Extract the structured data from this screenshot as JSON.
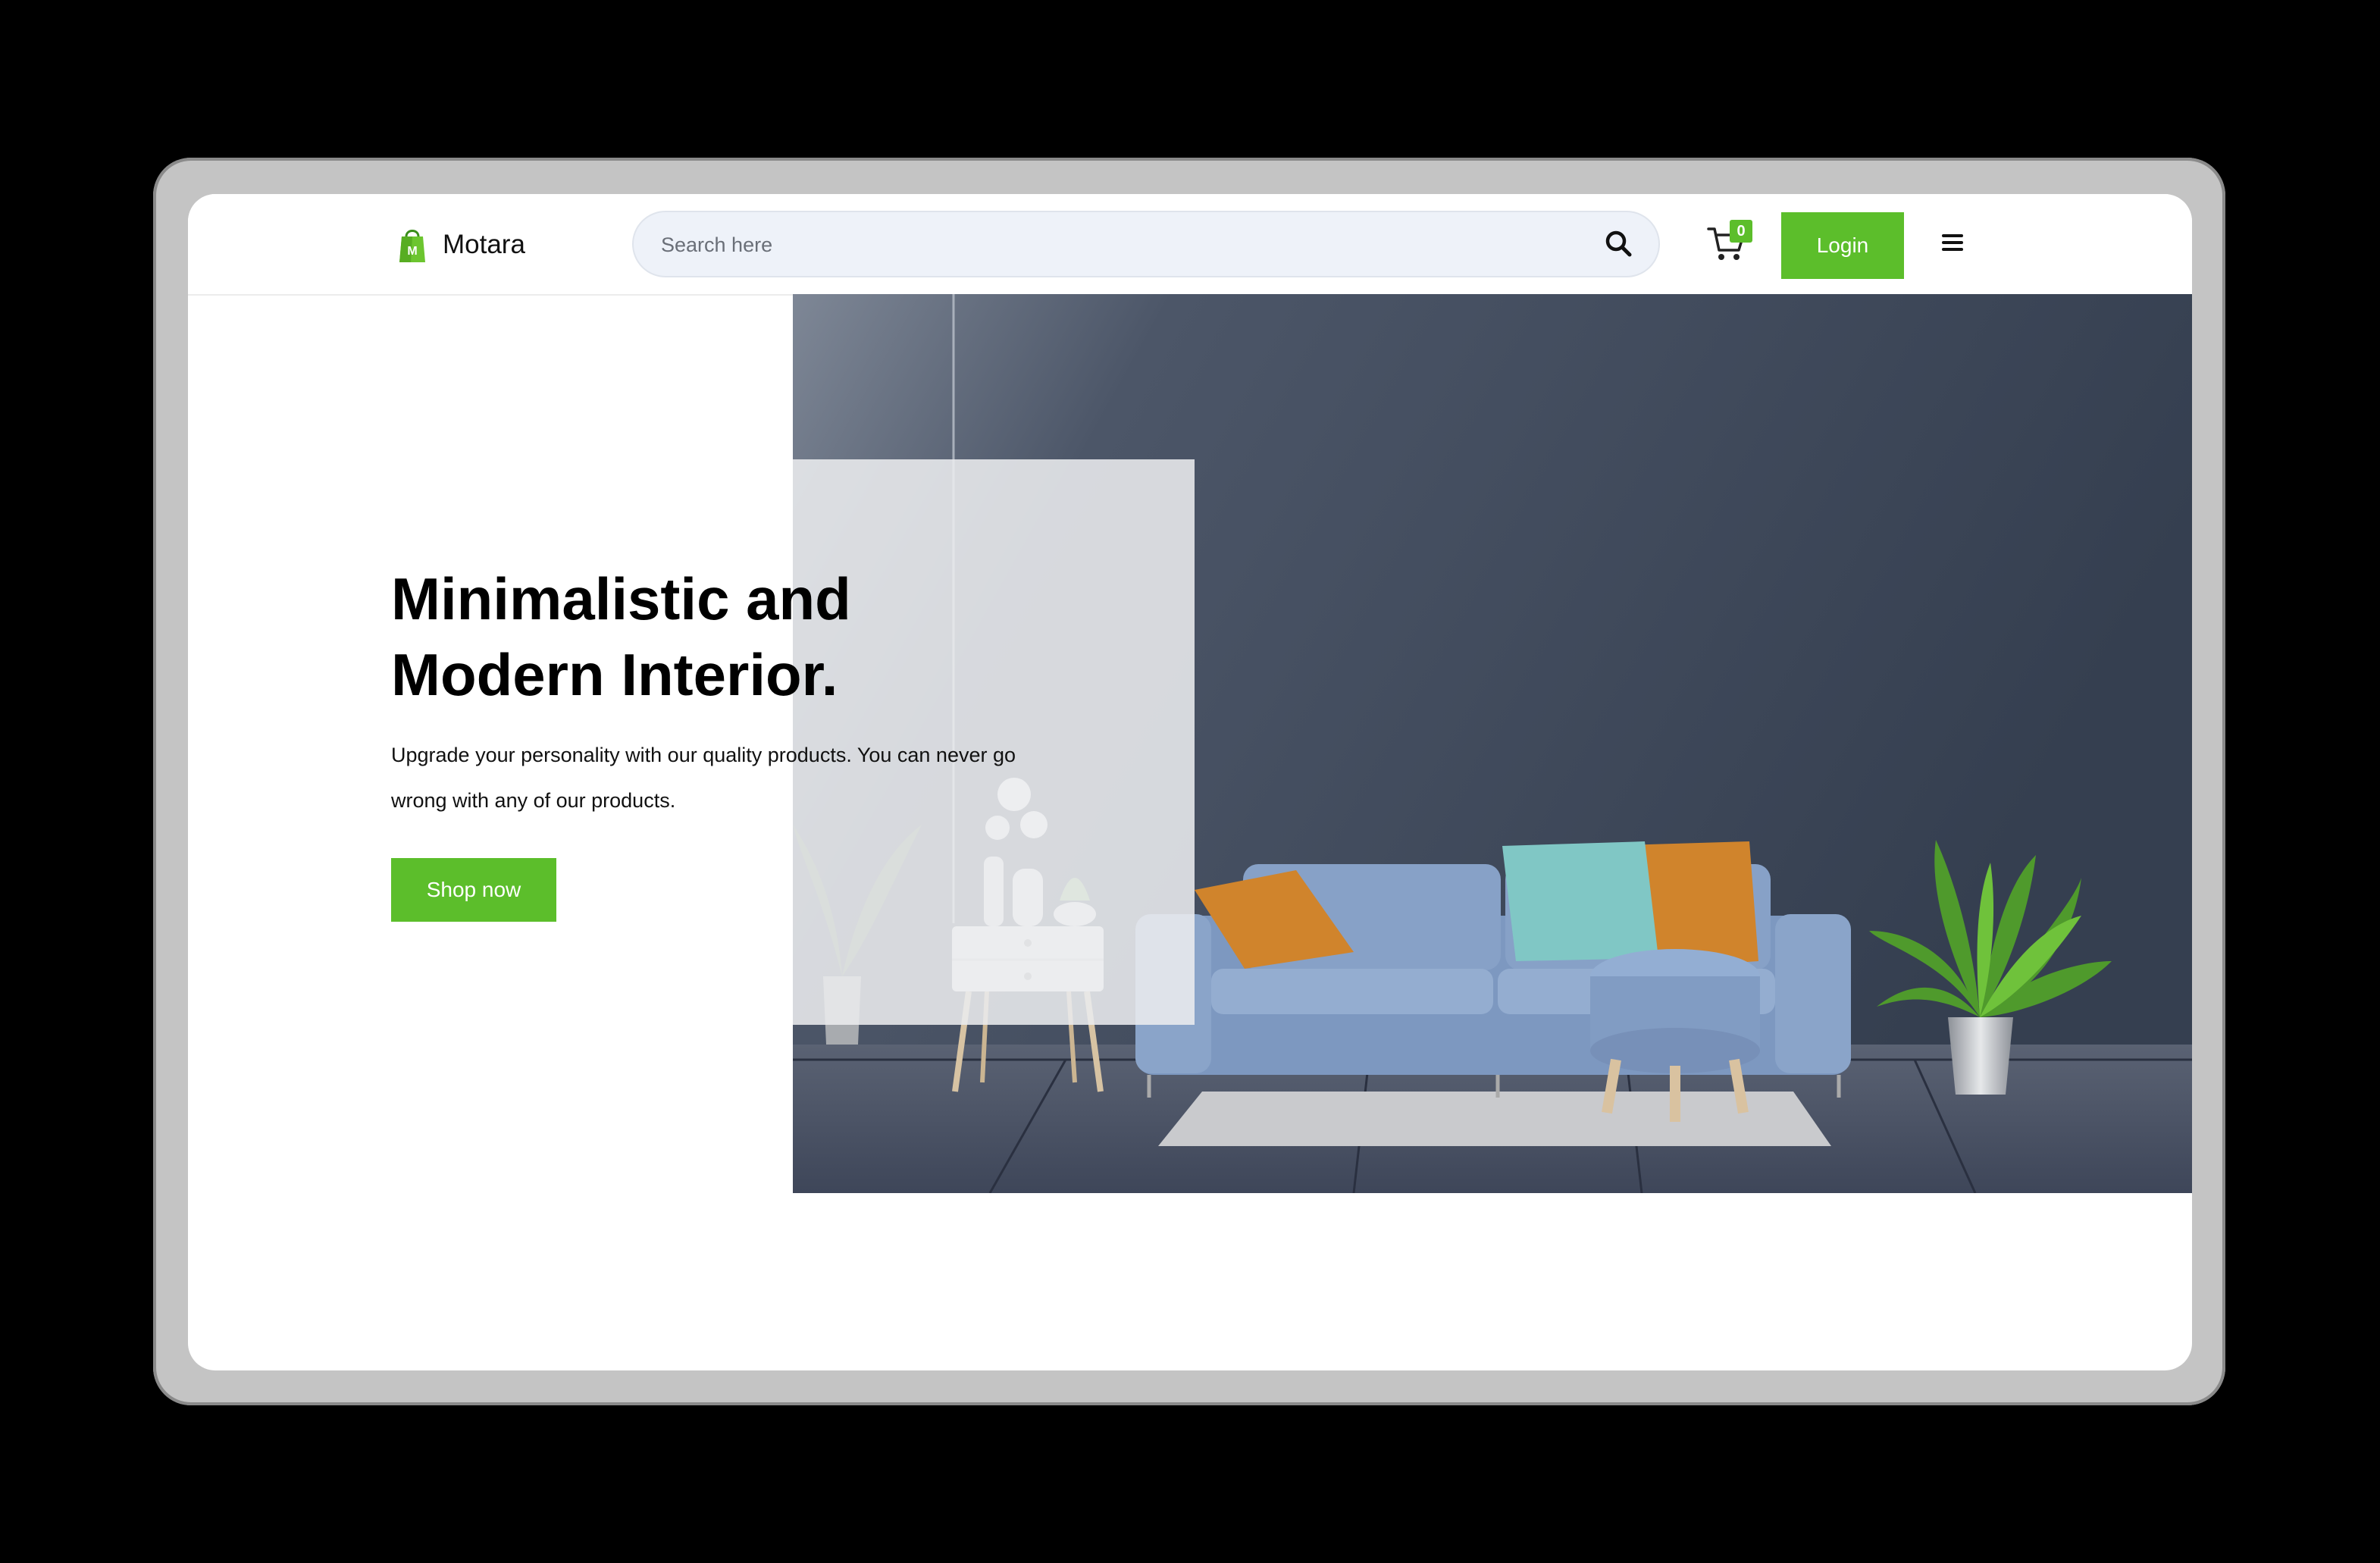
{
  "brand": {
    "name": "Motara",
    "logo_letter": "M",
    "logo_icon": "shopping-bag-icon"
  },
  "search": {
    "placeholder": "Search here",
    "value": "",
    "icon": "search-icon"
  },
  "cart": {
    "icon": "cart-icon",
    "count": "0"
  },
  "header": {
    "login_label": "Login",
    "menu_icon": "hamburger-menu-icon"
  },
  "hero": {
    "title_line1": "Minimalistic and",
    "title_line2": "Modern Interior.",
    "desc_line1": "Upgrade your personality with our quality products. You can never go",
    "desc_line2": "wrong with any of our products.",
    "cta_label": "Shop now",
    "image": "living-room-photo"
  },
  "colors": {
    "accent": "#5cbe2b",
    "wall": "#3a4556",
    "floor": "#4b5465",
    "sofa": "#7f9cc6",
    "pillow_orange": "#d0842c",
    "pillow_teal": "#7fc8c4"
  }
}
